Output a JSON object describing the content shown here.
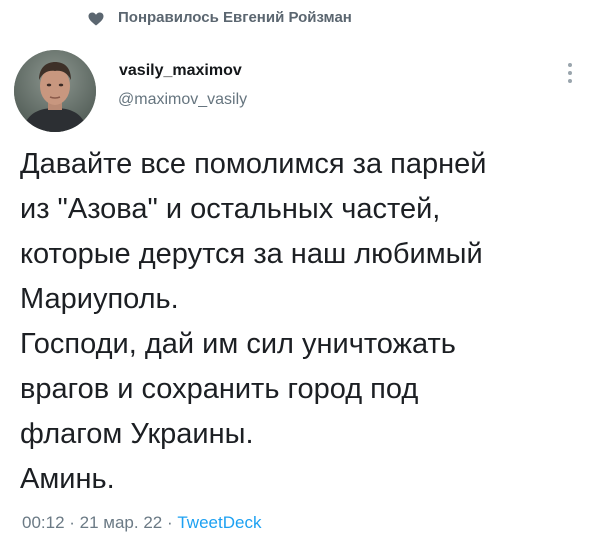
{
  "context": {
    "liked_by_text": "Понравилось Евгений Ройзман",
    "icon": "heart-icon"
  },
  "author": {
    "display_name": "vasily_maximov",
    "handle": "@maximov_vasily",
    "avatar_icon": "avatar-photo"
  },
  "tweet": {
    "lines": [
      "Давайте все помолимся за парней",
      "из \"Азова\" и остальных частей,",
      "которые дерутся за наш любимый",
      "Мариуполь.",
      "Господи, дай им сил уничтожать",
      "врагов и сохранить город под",
      "флагом Украины.",
      "Аминь."
    ]
  },
  "meta": {
    "time": "00:12",
    "separator": " · ",
    "date": "21 мар. 22",
    "source": "TweetDeck"
  },
  "colors": {
    "muted": "#66757f",
    "link": "#1da1f2",
    "text": "#14171a"
  }
}
